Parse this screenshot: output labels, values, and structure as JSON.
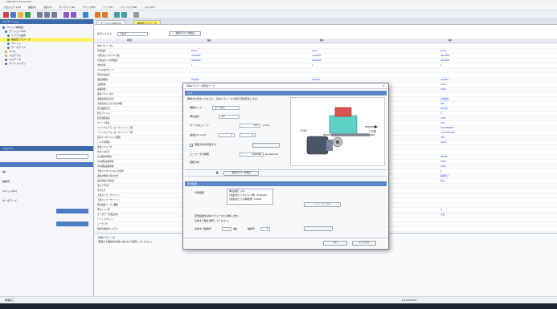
{
  "window": {
    "title": "MELSOFT GX Works3"
  },
  "menu": [
    "プロジェクト(P)",
    "編集(E)",
    "表示(V)",
    "オンライン(O)",
    "デバッグ(B)",
    "ツール(T)",
    "ウィンドウ(W)",
    "ヘルプ(H)"
  ],
  "left_pane": {
    "header": "ナビゲーション",
    "tree": [
      "ユニット構成図",
      "モーションCPU",
      "システム設定",
      "軸設定パラメータ",
      "ユニット",
      "サーボアンプ",
      "ラベル",
      "プログラム",
      "カムデータ",
      "デバイスメモリ"
    ],
    "lower_header": "プロパティ",
    "lower_items": [
      "軸1",
      "軸番号",
      "ユニット(Kn)",
      "サーボアンプ"
    ]
  },
  "tabs": [
    "モーションCPU(Q)",
    "軸設定パラメータ"
  ],
  "filter": {
    "label": "表示フィルタ",
    "value": "全表示",
    "button": "基本パラメータ確認"
  },
  "grid": {
    "headers": [
      "項目",
      "軸1",
      "軸2",
      "軸3"
    ],
    "rows": [
      [
        "基本パラメータ1",
        "",
        "",
        ""
      ],
      [
        "単位設定",
        "pulse",
        "pulse",
        "pulse"
      ],
      [
        "1回転あたりのパルス数",
        "4194304",
        "4194304",
        "4194304"
      ],
      [
        "1回転あたりの移動量",
        "4194304",
        "4194304",
        "4194304"
      ],
      [
        "単位倍率",
        "1",
        "1",
        "1"
      ],
      [
        "パルス出力モード",
        "",
        "",
        ""
      ],
      [
        "回転方向設定",
        "",
        "",
        ""
      ],
      [
        "速度制限値",
        "200000",
        "200000",
        "200000"
      ],
      [
        "加速時間",
        "1000",
        "1000",
        "1000"
      ],
      [
        "減速時間",
        "1000",
        "1000",
        "1000"
      ],
      [
        "基本パラメータ2",
        "",
        "",
        ""
      ],
      [
        "補間速度指定方式",
        "合成速度",
        "合成速度",
        "合成速度"
      ],
      [
        "位置決め完了信号出力時間",
        "300",
        "300",
        "300"
      ],
      [
        "原点復帰方式",
        "DOG型",
        "DOG型",
        "DOG型"
      ],
      [
        "原点アドレス",
        "0",
        "0",
        "0"
      ],
      [
        "原点復帰速度",
        "1000",
        "1000",
        "1000"
      ],
      [
        "クリープ速度",
        "100",
        "100",
        "100"
      ],
      [
        "ソフトウェアストロークリミット上限",
        "2147483647",
        "2147483647",
        "2147483647"
      ],
      [
        "ソフトウェアストロークリミット下限",
        "-2147483648",
        "-2147483648",
        "-2147483648"
      ],
      [
        "指令インポジション範囲",
        "100",
        "100",
        "100"
      ],
      [
        "トルク制限値",
        "300.0",
        "300.0",
        "300.0"
      ],
      [
        "拡張パラメータ",
        "",
        "",
        ""
      ],
      [
        "外部入力信号",
        "",
        "",
        ""
      ],
      [
        "JOG速度制限値",
        "20000",
        "20000",
        "20000"
      ],
      [
        "JOG運転加速時間",
        "1000",
        "1000",
        "1000"
      ],
      [
        "JOG運転減速時間",
        "1000",
        "1000",
        "1000"
      ],
      [
        "手動パルサ1パルス入力倍率",
        "1",
        "1",
        "1"
      ],
      [
        "運転中断時の停止方式",
        "減速停止",
        "減速停止",
        "減速停止"
      ],
      [
        "速度制御10倍指定",
        "無効",
        "無効",
        "無効"
      ],
      [
        "近点ドグ信号",
        "",
        "",
        ""
      ],
      [
        "停止信号",
        "",
        "",
        ""
      ],
      [
        "上限ストロークリミット",
        "",
        "",
        ""
      ],
      [
        "下限ストロークリミット",
        "",
        "",
        ""
      ],
      [
        "原点復帰リトライ機能",
        "",
        "",
        ""
      ],
      [
        "原点シフト量",
        "0",
        "0",
        "0"
      ],
      [
        "サーボモータ回転方向",
        "正転",
        "正転",
        "正転"
      ],
      [
        "ドライブユニット",
        "",
        "",
        ""
      ],
      [
        "シーケンサ",
        "",
        "",
        ""
      ],
      [
        "絶対位置検出システム",
        "",
        "",
        ""
      ]
    ]
  },
  "bottom_pane": {
    "title": "基本パラメータ",
    "text": "使用する機械の仕様に合わせて設定してください。"
  },
  "dialog": {
    "title": "基本パラメータ算出ツール",
    "section_input": "入力",
    "description": "機械の仕様を入力すると、基本パラメータの値を自動算出します。",
    "fields": [
      {
        "label": "機構タイプ",
        "value": "ボールねじ"
      },
      {
        "label": "単位設定",
        "value": "mm"
      },
      {
        "label": "ボールねじリード",
        "value": "10.0",
        "unit": "[mm]"
      },
      {
        "label": "減速比(n1:n2)",
        "value": "1",
        "value2": "1"
      },
      {
        "label": "エンコーダ分解能",
        "value": "4194304",
        "unit": "[pulse/rev]"
      },
      {
        "label": "回転方向",
        "value": ""
      }
    ],
    "checkbox_label": "回転方向を反転する",
    "cw_label": "CCW",
    "direction_label": "+ 方向",
    "calc_button": "基本パラメータ算出",
    "section_result": "算出結果",
    "result_label": "計算結果",
    "result_items": [
      "単位設定: mm",
      "1回転あたりのパルス数: 4194304",
      "1回転あたりの移動量: 10000"
    ],
    "apply_btn": "パラメータに反映",
    "note1": "算出結果を基本パラメータに反映します。",
    "note2": "反映する軸を選択してください。",
    "footer_label": "反映する軸番号",
    "footer_value": "1",
    "footer_unit": "[軸]",
    "footer_label2": "軸番号",
    "footer_value2": "1",
    "ok": "OK",
    "cancel": "キャンセル"
  },
  "status": {
    "left": "準備完了",
    "right": "Q172DSCPU"
  },
  "colors": {
    "selection": "#fff26a",
    "link": "#1a3fd0",
    "section": "#5b85c4"
  }
}
